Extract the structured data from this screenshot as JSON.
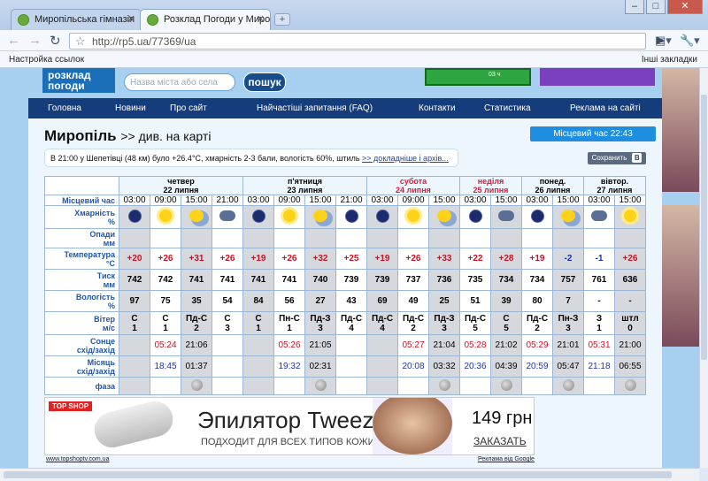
{
  "browser": {
    "tabs": [
      {
        "title": "Миропільська гімназія"
      },
      {
        "title": "Розклад Погоди у Мироп..."
      }
    ],
    "url": "http://rp5.ua/77369/ua",
    "bookmarks_left": "Настройка ссылок",
    "bookmarks_right": "Інші закладки"
  },
  "site": {
    "logo": "розклад погоди",
    "search_placeholder": "Назва міста або села",
    "search_button": "пошук",
    "ad_snippet": "03 ч",
    "nav": [
      "Головна",
      "Новини",
      "Про сайт",
      "Найчастіші запитання (FAQ)",
      "Контакти",
      "Статистика",
      "Реклама на сайті"
    ]
  },
  "page": {
    "city": "Миропіль",
    "map_link": ">> див. на карті",
    "local_time": "Місцевий час  22:43",
    "note_text": "В 21:00 у Шепетівці (48 км) було +26.4°C, хмарність 2-3 бали, вологість 60%, штиль",
    "note_link": ">> докладніше і архів...",
    "save_label": "Сохранить",
    "save_badge": "В"
  },
  "forecast": {
    "local_time_label": "Місцевий час",
    "days": [
      {
        "name": "четвер",
        "date": "22 липня",
        "red": false
      },
      {
        "name": "п'ятниця",
        "date": "23 липня",
        "red": false
      },
      {
        "name": "субота",
        "date": "24 липня",
        "red": true
      },
      {
        "name": "неділя",
        "date": "25 липня",
        "red": true
      },
      {
        "name": "понед.",
        "date": "26 липня",
        "red": false
      },
      {
        "name": "вівтор.",
        "date": "27 липня",
        "red": false
      }
    ],
    "hours": [
      "03:00",
      "09:00",
      "15:00",
      "21:00",
      "03:00",
      "09:00",
      "15:00",
      "21:00",
      "03:00",
      "09:00",
      "15:00",
      "03:00",
      "15:00",
      "03:00",
      "15:00",
      "03:00",
      "15:00"
    ],
    "labels": {
      "cloud": "Хмарність",
      "cloud_unit": "%",
      "precip": "Опади",
      "precip_unit": "мм",
      "temp": "Температура",
      "temp_unit": "°C",
      "pressure": "Тиск",
      "pressure_unit": "мм",
      "humidity": "Вологість",
      "humidity_unit": "%",
      "wind": "Вітер",
      "wind_unit": "м/с",
      "sun": "Сонце",
      "sun_sub": "схід/захід",
      "moon": "Місяць",
      "moon_sub": "схід/захід",
      "phase": "фаза"
    },
    "cloud_icons": [
      "moon",
      "sun",
      "partly",
      "cloud",
      "moon",
      "sun",
      "partly",
      "moon",
      "moon",
      "sun",
      "partly",
      "moon",
      "cloud",
      "moon",
      "partly",
      "cloud",
      "sun"
    ],
    "temps": [
      "+20",
      "+26",
      "+31",
      "+26",
      "+19",
      "+26",
      "+32",
      "+25",
      "+19",
      "+26",
      "+33",
      "+22",
      "+28",
      "+19",
      "-2",
      "-1",
      "+26"
    ],
    "pressure": [
      "742",
      "742",
      "741",
      "741",
      "741",
      "741",
      "740",
      "739",
      "739",
      "737",
      "736",
      "735",
      "734",
      "734",
      "757",
      "761",
      "636"
    ],
    "humidity": [
      "97",
      "75",
      "35",
      "54",
      "84",
      "56",
      "27",
      "43",
      "69",
      "49",
      "25",
      "51",
      "39",
      "80",
      "7",
      "-",
      "-"
    ],
    "wind_dir": [
      "С",
      "С",
      "Пд-С",
      "С",
      "С",
      "Пн-С",
      "Пд-З",
      "Пд-С",
      "Пд-С",
      "Пд-С",
      "Пд-З",
      "Пд-С",
      "С",
      "Пд-С",
      "Пн-З",
      "З",
      "штл"
    ],
    "wind_speed": [
      "1",
      "1",
      "2",
      "3",
      "1",
      "1",
      "3",
      "4",
      "4",
      "2",
      "3",
      "5",
      "5",
      "2",
      "3",
      "1",
      "0"
    ],
    "sunrise": [
      "05:24",
      "05:26",
      "05:27",
      "05:28",
      "05:29",
      "05:31"
    ],
    "sunset": [
      "21:06",
      "21:05",
      "21:04",
      "21:02",
      "21:01",
      "21:00"
    ],
    "moonrise": [
      "18:45",
      "19:32",
      "20:08",
      "20:36",
      "20:59",
      "21:18"
    ],
    "moonset": [
      "01:37",
      "02:31",
      "03:32",
      "04:39",
      "05:47",
      "06:55"
    ]
  },
  "banner": {
    "brand": "TOP SHOP",
    "title": "Эпилятор Tweezer",
    "subtitle": "ПОДХОДИТ ДЛЯ ВСЕХ ТИПОВ КОЖИ",
    "price": "149 грн",
    "buy": "ЗАКАЗАТЬ",
    "link_left": "www.topshoptv.com.ua",
    "link_right": "Реклама від Google"
  }
}
